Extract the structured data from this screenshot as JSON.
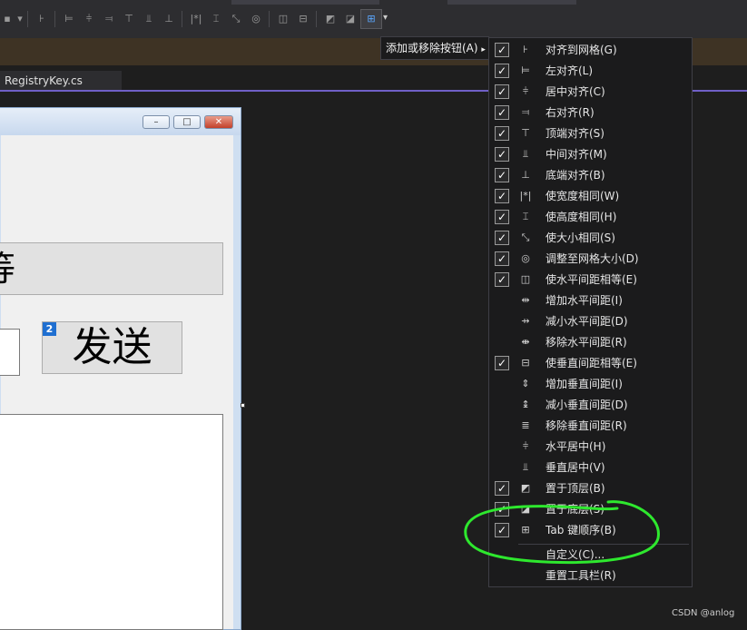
{
  "toolbar": {
    "dropdown_label": "添加或移除按钮(A)",
    "icons": [
      "align-grid-icon",
      "align-left-icon",
      "align-center-icon",
      "align-right-icon",
      "align-top-icon",
      "align-middle-icon",
      "align-bottom-icon",
      "same-width-icon",
      "same-height-icon",
      "same-size-icon",
      "size-to-grid-icon",
      "hspacing-equal-icon",
      "vspacing-equal-icon",
      "bring-to-front-icon",
      "send-to-back-icon",
      "tab-order-icon"
    ]
  },
  "editor_tab": {
    "filename": "RegistryKey.cs"
  },
  "form": {
    "textbox_glyph": "等",
    "send_button": "发送",
    "tab_index_badge": "2",
    "window_buttons": [
      "–",
      "□",
      "✕"
    ]
  },
  "menu": {
    "items": [
      {
        "label": "对齐到网格(G)",
        "checked": true,
        "icon": "align-grid-icon",
        "glyph": "⊦"
      },
      {
        "label": "左对齐(L)",
        "checked": true,
        "icon": "align-left-icon",
        "glyph": "⊨"
      },
      {
        "label": "居中对齐(C)",
        "checked": true,
        "icon": "align-center-icon",
        "glyph": "⫩"
      },
      {
        "label": "右对齐(R)",
        "checked": true,
        "icon": "align-right-icon",
        "glyph": "⫤"
      },
      {
        "label": "顶端对齐(S)",
        "checked": true,
        "icon": "align-top-icon",
        "glyph": "⊤"
      },
      {
        "label": "中间对齐(M)",
        "checked": true,
        "icon": "align-middle-icon",
        "glyph": "⫫"
      },
      {
        "label": "底端对齐(B)",
        "checked": true,
        "icon": "align-bottom-icon",
        "glyph": "⊥"
      },
      {
        "label": "使宽度相同(W)",
        "checked": true,
        "icon": "same-width-icon",
        "glyph": "|*|"
      },
      {
        "label": "使高度相同(H)",
        "checked": true,
        "icon": "same-height-icon",
        "glyph": "⌶"
      },
      {
        "label": "使大小相同(S)",
        "checked": true,
        "icon": "same-size-icon",
        "glyph": "⤡"
      },
      {
        "label": "调整至网格大小(D)",
        "checked": true,
        "icon": "size-to-grid-icon",
        "glyph": "◎"
      },
      {
        "label": "使水平间距相等(E)",
        "checked": true,
        "icon": "hspacing-equal-icon",
        "glyph": "◫"
      },
      {
        "label": "增加水平间距(I)",
        "checked": false,
        "icon": "increase-hspacing-icon",
        "glyph": "⇹"
      },
      {
        "label": "减小水平间距(D)",
        "checked": false,
        "icon": "decrease-hspacing-icon",
        "glyph": "⇸"
      },
      {
        "label": "移除水平间距(R)",
        "checked": false,
        "icon": "remove-hspacing-icon",
        "glyph": "⇼"
      },
      {
        "label": "使垂直间距相等(E)",
        "checked": true,
        "icon": "vspacing-equal-icon",
        "glyph": "⊟"
      },
      {
        "label": "增加垂直间距(I)",
        "checked": false,
        "icon": "increase-vspacing-icon",
        "glyph": "⇕"
      },
      {
        "label": "减小垂直间距(D)",
        "checked": false,
        "icon": "decrease-vspacing-icon",
        "glyph": "↨"
      },
      {
        "label": "移除垂直间距(R)",
        "checked": false,
        "icon": "remove-vspacing-icon",
        "glyph": "≣"
      },
      {
        "label": "水平居中(H)",
        "checked": false,
        "icon": "center-horizontally-icon",
        "glyph": "⫩"
      },
      {
        "label": "垂直居中(V)",
        "checked": false,
        "icon": "center-vertically-icon",
        "glyph": "⫫"
      },
      {
        "label": "置于顶层(B)",
        "checked": true,
        "icon": "bring-to-front-icon",
        "glyph": "◩"
      },
      {
        "label": "置于底层(S)",
        "checked": true,
        "icon": "send-to-back-icon",
        "glyph": "◪"
      },
      {
        "label": "Tab 键顺序(B)",
        "checked": true,
        "icon": "tab-order-icon",
        "glyph": "⊞"
      },
      {
        "label": "自定义(C)...",
        "checked": null,
        "icon": "",
        "glyph": ""
      },
      {
        "label": "重置工具栏(R)",
        "checked": null,
        "icon": "",
        "glyph": ""
      }
    ]
  },
  "watermark": "CSDN @anlog",
  "colors": {
    "menu_bg": "#1b1b1c",
    "accent": "#6f5fc6",
    "annotation": "#2ee82e",
    "badge": "#1f6fd1"
  }
}
